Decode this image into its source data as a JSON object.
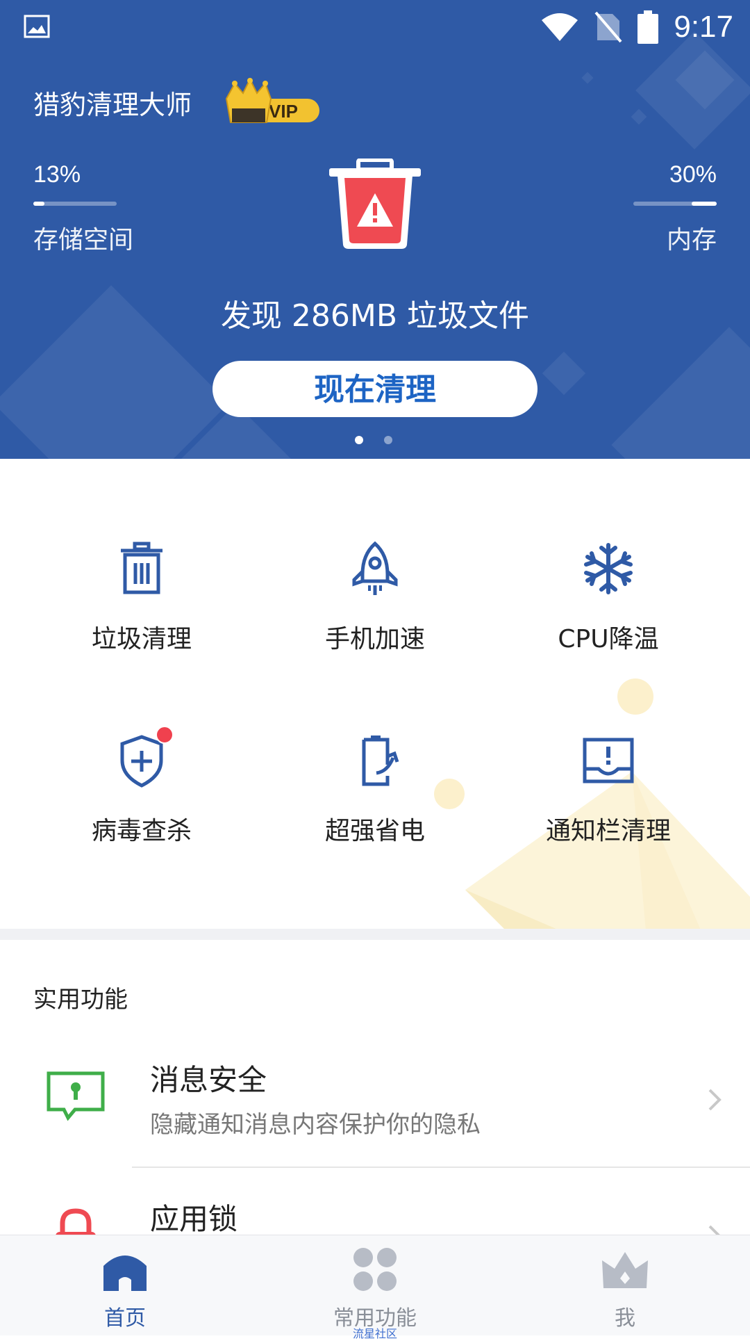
{
  "status_bar": {
    "time": "9:17"
  },
  "header": {
    "app_title": "猎豹清理大师",
    "vip_label": "VIP",
    "storage": {
      "percent_text": "13%",
      "label": "存储空间",
      "fill": 0.13
    },
    "memory": {
      "percent_text": "30%",
      "label": "内存",
      "fill": 0.3
    },
    "junk_found": "发现 286MB 垃圾文件",
    "clean_button": "现在清理",
    "pager": {
      "pages": 2,
      "active": 1
    }
  },
  "tools": [
    {
      "label": "垃圾清理",
      "icon": "trash-icon"
    },
    {
      "label": "手机加速",
      "icon": "rocket-icon"
    },
    {
      "label": "CPU降温",
      "icon": "snowflake-icon"
    },
    {
      "label": "病毒查杀",
      "icon": "shield-plus-icon",
      "has_badge": true
    },
    {
      "label": "超强省电",
      "icon": "battery-cycle-icon"
    },
    {
      "label": "通知栏清理",
      "icon": "notification-tray-icon"
    }
  ],
  "practical": {
    "section_title": "实用功能",
    "items": [
      {
        "title": "消息安全",
        "subtitle": "隐藏通知消息内容保护你的隐私",
        "icon": "message-lock-icon"
      },
      {
        "title": "应用锁",
        "subtitle": "",
        "icon": "padlock-icon"
      }
    ]
  },
  "bottom_nav": {
    "items": [
      {
        "label": "首页",
        "icon": "home-icon",
        "active": true
      },
      {
        "label": "常用功能",
        "sublabel": "流星社区",
        "icon": "grid-dots-icon"
      },
      {
        "label": "我",
        "icon": "crown-icon"
      }
    ]
  },
  "colors": {
    "header_bg": "#2f5aa6",
    "accent_blue": "#1d64c4",
    "icon_blue": "#2f5aa6",
    "badge_red": "#f0414e",
    "trash_red": "#ef4a52",
    "message_green": "#3fae49",
    "vip_gold": "#f2c230"
  }
}
